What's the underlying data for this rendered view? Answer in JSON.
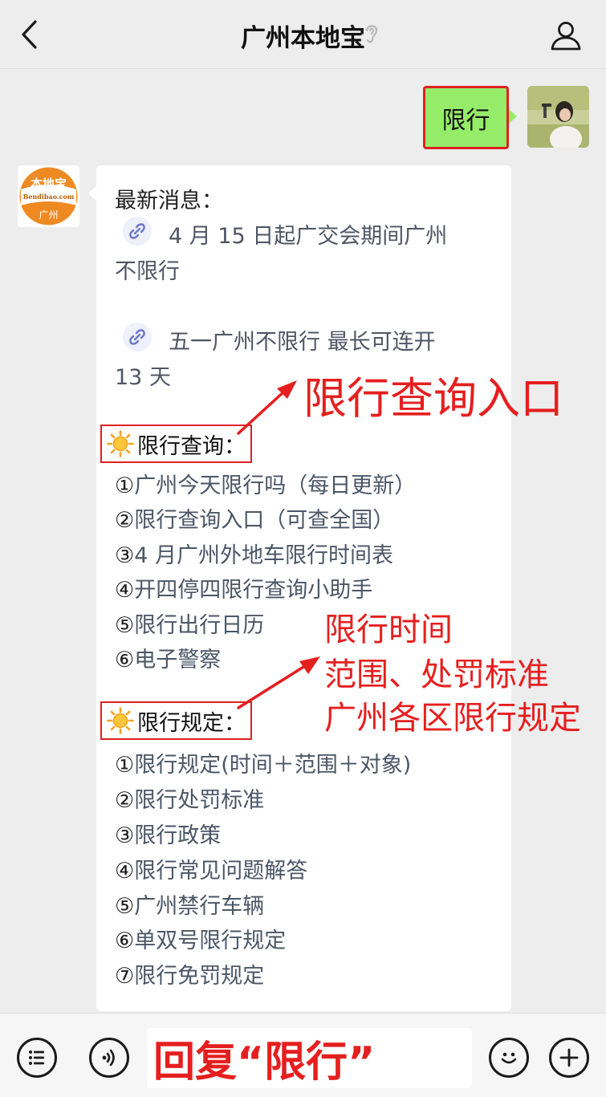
{
  "header": {
    "title": "广州本地宝"
  },
  "outgoing": {
    "text": "限行"
  },
  "bot_avatar": {
    "logo_main": "本地宝",
    "logo_sub": "Bendibao.com",
    "city": "广州"
  },
  "message": {
    "intro": "最新消息：",
    "links": [
      {
        "line1": "4 月 15 日起广交会期间广州",
        "line2": "不限行"
      },
      {
        "line1": "五一广州不限行 最长可连开",
        "line2": "13 天"
      }
    ],
    "section1": {
      "title": "限行查询：",
      "items": [
        {
          "num": "①",
          "text": "广州今天限行吗（每日更新）"
        },
        {
          "num": "②",
          "text": "限行查询入口（可查全国）"
        },
        {
          "num": "③",
          "text": "4 月广州外地车限行时间表"
        },
        {
          "num": "④",
          "text": "开四停四限行查询小助手"
        },
        {
          "num": "⑤",
          "text": "限行出行日历"
        },
        {
          "num": "⑥",
          "text": "电子警察"
        }
      ]
    },
    "section2": {
      "title": "限行规定：",
      "items": [
        {
          "num": "①",
          "text": "限行规定(时间＋范围＋对象)"
        },
        {
          "num": "②",
          "text": "限行处罚标准"
        },
        {
          "num": "③",
          "text": "限行政策"
        },
        {
          "num": "④",
          "text": "限行常见问题解答"
        },
        {
          "num": "⑤",
          "text": "广州禁行车辆"
        },
        {
          "num": "⑥",
          "text": "单双号限行规定"
        },
        {
          "num": "⑦",
          "text": "限行免罚规定"
        }
      ]
    }
  },
  "annotations": {
    "query_entry": "限行查询入口",
    "time_line1": "限行时间",
    "time_line2": "范围、处罚标准",
    "time_line3": "广州各区限行规定"
  },
  "input_bar": {
    "reply_hint": "回复“限行”"
  },
  "icons": {
    "back": "chevron-left-icon",
    "ear": "ear-icon",
    "profile": "person-icon",
    "menu": "menu-list-icon",
    "voice": "voice-icon",
    "emoji": "emoji-icon",
    "plus": "plus-icon",
    "link": "mini-program-link-icon",
    "sun": "sun-icon"
  },
  "colors": {
    "outgoing_bubble": "#95ec69",
    "annotation_red": "#e51f1f",
    "background": "#ededed",
    "card": "#ffffff"
  }
}
